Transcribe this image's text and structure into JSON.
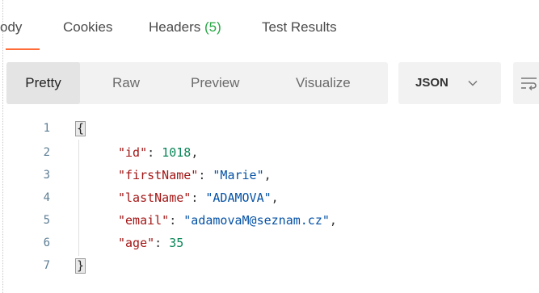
{
  "tabs": {
    "body": "ody",
    "cookies": "Cookies",
    "headers": "Headers",
    "headers_count": "(5)",
    "test_results": "Test Results"
  },
  "toolbar": {
    "pretty": "Pretty",
    "raw": "Raw",
    "preview": "Preview",
    "visualize": "Visualize",
    "format": "JSON",
    "active_tab": "Pretty"
  },
  "code": {
    "line_numbers": [
      "1",
      "2",
      "3",
      "4",
      "5",
      "6",
      "7"
    ],
    "open_brace": "{",
    "close_brace": "}",
    "fields": [
      {
        "key": "\"id\"",
        "value": "1018",
        "type": "number",
        "comma": ","
      },
      {
        "key": "\"firstName\"",
        "value": "\"Marie\"",
        "type": "string",
        "comma": ","
      },
      {
        "key": "\"lastName\"",
        "value": "\"ADAMOVA\"",
        "type": "string",
        "comma": ","
      },
      {
        "key": "\"email\"",
        "value": "\"adamovaM@seznam.cz\"",
        "type": "string",
        "comma": ","
      },
      {
        "key": "\"age\"",
        "value": "35",
        "type": "number",
        "comma": ""
      }
    ],
    "colon": ": "
  },
  "colors": {
    "accent": "#ff6c37",
    "count": "#28a745",
    "key": "#a31515",
    "number": "#098658",
    "string": "#0451a5"
  },
  "icons": {
    "format_dropdown": "chevron-down-icon",
    "wrap": "wrap-lines-icon"
  }
}
